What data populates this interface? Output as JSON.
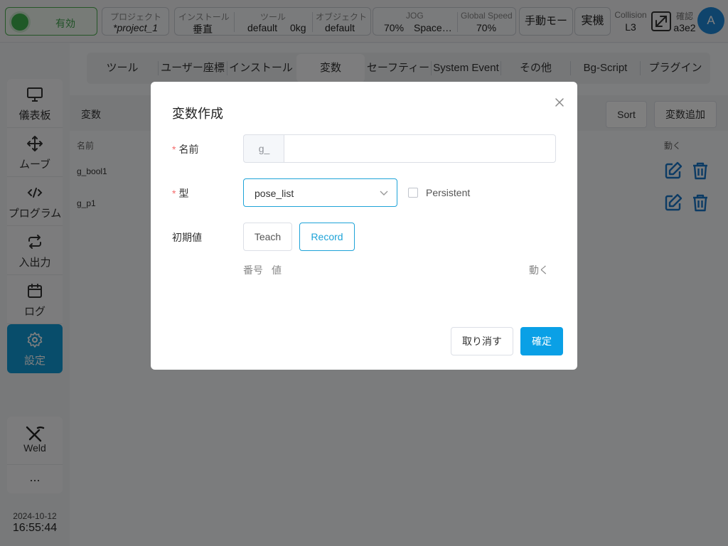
{
  "topbar": {
    "status": "有効",
    "project": {
      "label": "プロジェクト",
      "value": "*project_1"
    },
    "install": {
      "label": "インストール",
      "value": "垂直"
    },
    "tool": {
      "label": "ツール",
      "name": "default",
      "load": "0kg"
    },
    "object": {
      "label": "オブジェクト",
      "value": "default"
    },
    "jog": {
      "label": "JOG",
      "speed": "70%",
      "frame": "Space…"
    },
    "global_speed": {
      "label": "Global Speed",
      "value": "70%"
    },
    "manual_mode": "手動モード",
    "real_robot": "実機",
    "collision": {
      "label": "Collision",
      "value": "L3"
    },
    "confirm": {
      "label": "確認",
      "value": "a3e2"
    },
    "avatar": "A"
  },
  "sidebar": {
    "items": [
      {
        "label": "儀表板",
        "icon": "monitor-icon"
      },
      {
        "label": "ムーブ",
        "icon": "move-arrows-icon"
      },
      {
        "label": "プログラム",
        "icon": "code-icon"
      },
      {
        "label": "入出力",
        "icon": "repeat-icon"
      },
      {
        "label": "ログ",
        "icon": "calendar-icon"
      },
      {
        "label": "設定",
        "icon": "gear-icon",
        "active": true
      }
    ],
    "weld": "Weld",
    "more": "..."
  },
  "datetime": {
    "date": "2024-10-12",
    "time": "16:55:44"
  },
  "tabs": [
    {
      "label": "ツール"
    },
    {
      "label": "ユーザー座標"
    },
    {
      "label": "インストール"
    },
    {
      "label": "変数",
      "active": true
    },
    {
      "label": "セーフティー"
    },
    {
      "label": "System Event"
    },
    {
      "label": "その他"
    },
    {
      "label": "Bg-Script"
    },
    {
      "label": "プラグイン"
    }
  ],
  "variables": {
    "title": "変数",
    "sort_label": "Sort",
    "add_label": "変数追加",
    "col_name": "名前",
    "col_action": "動く",
    "rows": [
      {
        "name": "g_bool1"
      },
      {
        "name": "g_p1"
      }
    ]
  },
  "dialog": {
    "title": "変数作成",
    "name_label": "名前",
    "name_prefix": "g_",
    "name_value": "",
    "type_label": "型",
    "type_value": "pose_list",
    "persistent_label": "Persistent",
    "persistent_checked": false,
    "initial_label": "初期値",
    "teach_label": "Teach",
    "record_label": "Record",
    "list_col_index": "番号",
    "list_col_value": "値",
    "list_col_action": "動く",
    "cancel_label": "取り消す",
    "ok_label": "確定"
  },
  "colors": {
    "accent": "#0aa0e6",
    "active_sidebar": "#109bd6",
    "status_green": "#3fb34f",
    "action_icon": "#1876c9"
  }
}
